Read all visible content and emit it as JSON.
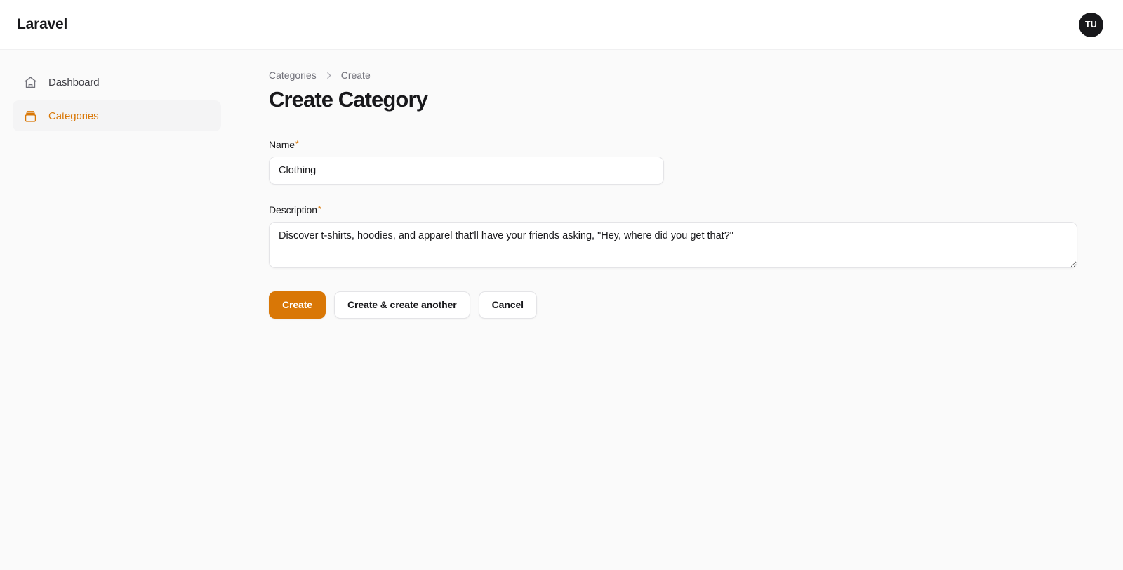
{
  "header": {
    "brand": "Laravel",
    "avatar_initials": "TU"
  },
  "sidebar": {
    "items": [
      {
        "label": "Dashboard",
        "icon": "home-icon",
        "active": false
      },
      {
        "label": "Categories",
        "icon": "archive-box-icon",
        "active": true
      }
    ]
  },
  "breadcrumb": {
    "items": [
      {
        "label": "Categories"
      },
      {
        "label": "Create"
      }
    ],
    "separator": "›"
  },
  "page": {
    "title": "Create Category"
  },
  "form": {
    "name_field": {
      "label": "Name",
      "required_marker": "*",
      "value": "Clothing",
      "placeholder": ""
    },
    "description_field": {
      "label": "Description",
      "required_marker": "*",
      "value": "Discover t-shirts, hoodies, and apparel that'll have your friends asking, \"Hey, where did you get that?\"",
      "placeholder": ""
    }
  },
  "actions": {
    "create_label": "Create",
    "create_another_label": "Create & create another",
    "cancel_label": "Cancel"
  },
  "colors": {
    "accent": "#d97706",
    "page_background": "#fafafa",
    "header_background": "#ffffff",
    "text_primary": "#18181b",
    "text_muted": "#71717a",
    "border": "#e4e4e7",
    "active_nav_background": "#f4f4f5",
    "avatar_background": "#18181b"
  }
}
